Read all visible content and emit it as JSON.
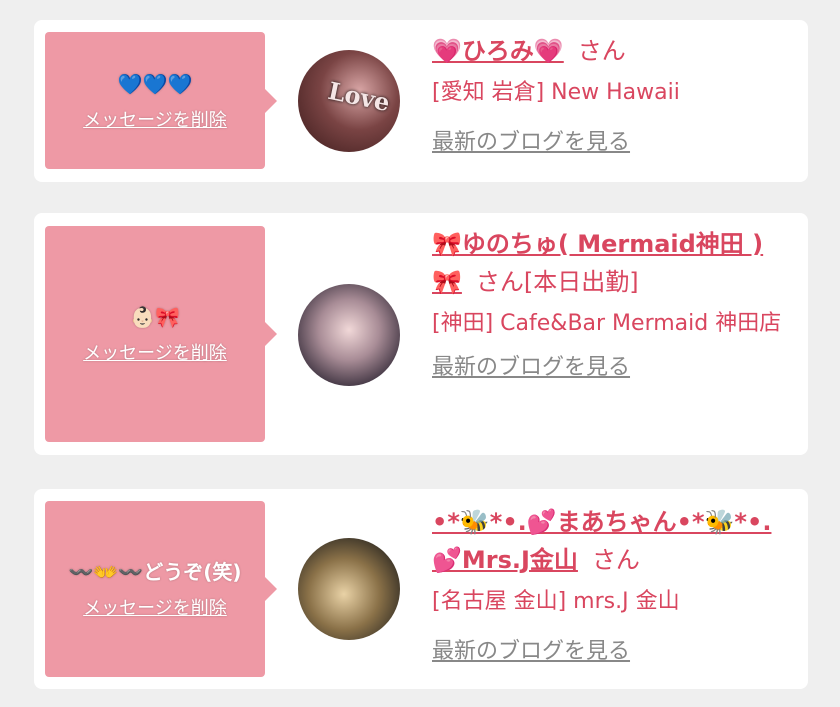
{
  "messages": [
    {
      "message": "💙💙💙",
      "delete_label": "メッセージを削除",
      "name": "💗ひろみ💗",
      "honorific": "さん",
      "shop": "[愛知 岩倉] New Hawaii",
      "blog_label": "最新のブログを見る",
      "avatar_text": "Love"
    },
    {
      "message": "👶🏻🎀",
      "delete_label": "メッセージを削除",
      "name": "🎀ゆのちゅ( Mermaid神田 ) 🎀",
      "honorific": "さん[本日出勤]",
      "shop": "[神田] Cafe&Bar Mermaid 神田店",
      "blog_label": "最新のブログを見る"
    },
    {
      "message": "〰️👐〰️どうぞ(笑)",
      "delete_label": "メッセージを削除",
      "name": "•*🐝*•.💕まあちゃん•*🐝*•.💕Mrs.J金山",
      "honorific": "さん",
      "shop": "[名古屋 金山] mrs.J 金山",
      "blog_label": "最新のブログを見る"
    }
  ],
  "colors": {
    "accent_pink": "#ee99a5",
    "name_red": "#d9465f",
    "link_gray": "#888888",
    "background": "#efefef"
  }
}
